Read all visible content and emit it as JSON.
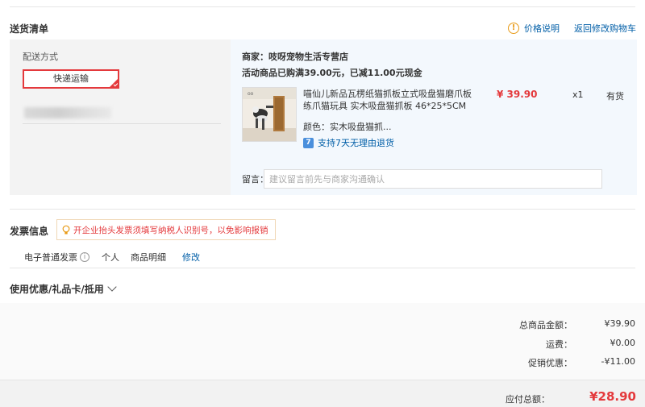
{
  "header": {
    "title": "送货清单",
    "price_help": "价格说明",
    "back_to_cart": "返回修改购物车"
  },
  "shipping": {
    "label": "配送方式",
    "method": "快递运输"
  },
  "shop": {
    "name": "商家：吱呀宠物生活专营店",
    "promo": "活动商品已购满39.00元，已减11.00元现金",
    "product": {
      "name": "喵仙儿新品瓦楞纸猫抓板立式吸盘猫磨爪板练爪猫玩具 实木吸盘猫抓板 46*25*5CM",
      "price": "¥ 39.90",
      "quantity": "x1",
      "stock": "有货",
      "spec": "颜色：实木吸盘猫抓...",
      "return_policy": "支持7天无理由退货",
      "return_icon": "7"
    },
    "remark_label": "留言：",
    "remark_placeholder": "建议留言前先与商家沟通确认"
  },
  "invoice": {
    "title": "发票信息",
    "tip": "开企业抬头发票须填写纳税人识别号，以免影响报销",
    "type": "电子普通发票",
    "info_icon": "i",
    "holder": "个人",
    "content": "商品明细",
    "modify": "修改"
  },
  "coupon": {
    "label": "使用优惠/礼品卡/抵用"
  },
  "summary": {
    "goods_label": "总商品金额：",
    "goods_value": "¥39.90",
    "freight_label": "运费：",
    "freight_value": "¥0.00",
    "discount_label": "促销优惠：",
    "discount_value": "-¥11.00"
  },
  "pay": {
    "label": "应付总额：",
    "value": "¥28.90"
  },
  "colors": {
    "accent_red": "#e4393c",
    "link_blue": "#005ea7",
    "warn_orange": "#e89b18"
  }
}
